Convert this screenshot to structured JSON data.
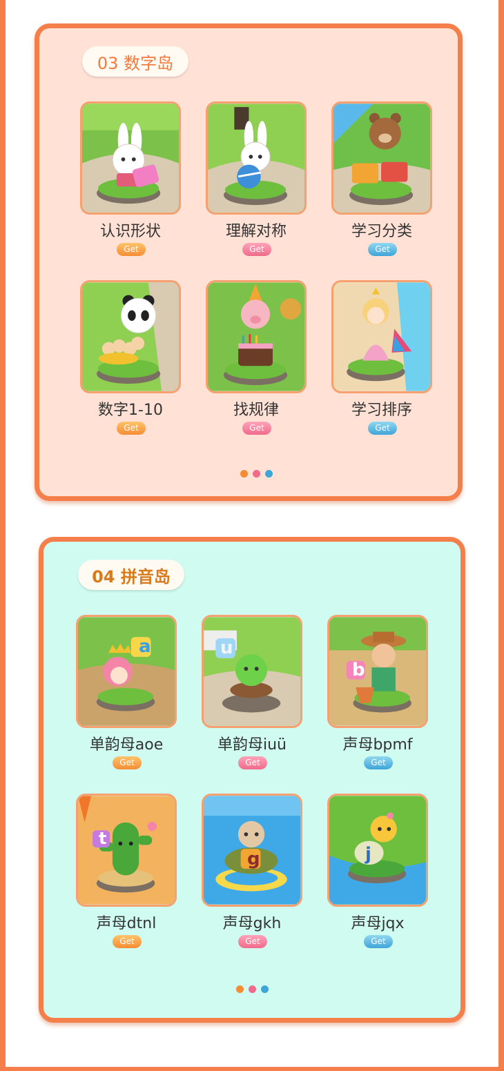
{
  "section3": {
    "title": "03 数字岛",
    "items": [
      {
        "label": "认识形状",
        "badge": "Get",
        "badge_color": "orange",
        "scene": "rabbit-tablet"
      },
      {
        "label": "理解对称",
        "badge": "Get",
        "badge_color": "pink",
        "scene": "rabbit-ball"
      },
      {
        "label": "学习分类",
        "badge": "Get",
        "badge_color": "blue",
        "scene": "bear-boxes"
      },
      {
        "label": "数字1-10",
        "badge": "Get",
        "badge_color": "orange",
        "scene": "panda-numbers"
      },
      {
        "label": "找规律",
        "badge": "Get",
        "badge_color": "pink",
        "scene": "pig-cake"
      },
      {
        "label": "学习排序",
        "badge": "Get",
        "badge_color": "blue",
        "scene": "princess"
      }
    ],
    "pagination": [
      "#f58c34",
      "#ef6a8b",
      "#3fa4d8"
    ]
  },
  "section4": {
    "title": "04 拼音岛",
    "items": [
      {
        "label": "单韵母aoe",
        "badge": "Get",
        "badge_color": "orange",
        "scene": "fairy-a",
        "letter": "a"
      },
      {
        "label": "单韵母iuü",
        "badge": "Get",
        "badge_color": "pink",
        "scene": "sprout-u",
        "letter": "u"
      },
      {
        "label": "声母bpmf",
        "badge": "Get",
        "badge_color": "blue",
        "scene": "gardener-b",
        "letter": "b"
      },
      {
        "label": "声母dtnl",
        "badge": "Get",
        "badge_color": "orange",
        "scene": "cactus-t",
        "letter": "t"
      },
      {
        "label": "声母gkh",
        "badge": "Get",
        "badge_color": "pink",
        "scene": "turtle-g",
        "letter": "g"
      },
      {
        "label": "声母jqx",
        "badge": "Get",
        "badge_color": "blue",
        "scene": "snail-j",
        "letter": "j"
      }
    ],
    "pagination": [
      "#f58c34",
      "#ef6a8b",
      "#3fa4d8"
    ]
  }
}
